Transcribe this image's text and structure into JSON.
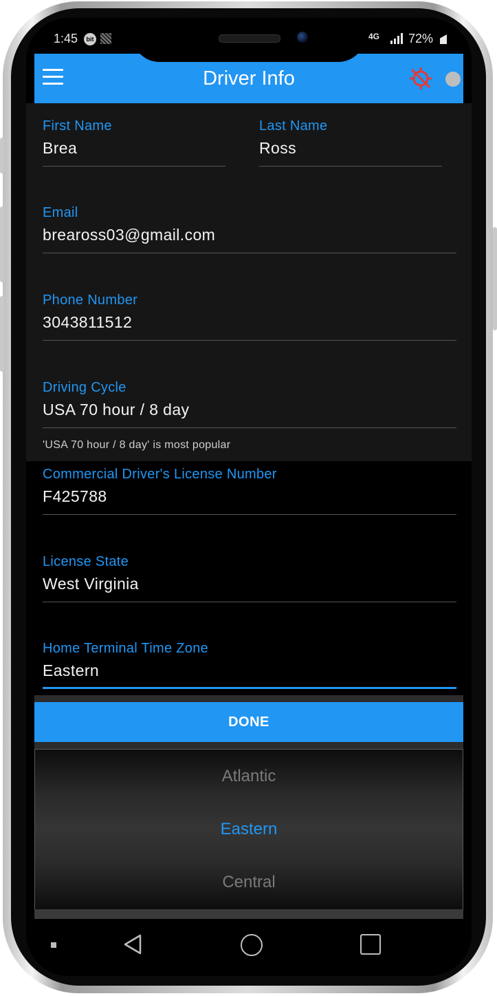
{
  "status_bar": {
    "time": "1:45",
    "bt_label": "bit",
    "network": "4G",
    "battery": "72%"
  },
  "app_bar": {
    "title": "Driver Info"
  },
  "form": {
    "first_name": {
      "label": "First Name",
      "value": "Brea"
    },
    "last_name": {
      "label": "Last Name",
      "value": "Ross"
    },
    "email": {
      "label": "Email",
      "value": "breaross03@gmail.com"
    },
    "phone": {
      "label": "Phone Number",
      "value": "3043811512"
    },
    "driving_cycle": {
      "label": "Driving Cycle",
      "value": "USA 70 hour / 8 day",
      "helper": "'USA 70 hour / 8 day' is most popular"
    },
    "license_number": {
      "label": "Commercial Driver's License Number",
      "value": "F425788"
    },
    "license_state": {
      "label": "License State",
      "value": "West Virginia"
    },
    "time_zone": {
      "label": "Home Terminal Time Zone",
      "value": "Eastern"
    }
  },
  "picker": {
    "done_label": "DONE",
    "options": [
      "Atlantic",
      "Eastern",
      "Central"
    ],
    "selected": "Eastern"
  },
  "colors": {
    "accent": "#2196f3",
    "background": "#161616",
    "gps_off": "#e53935"
  },
  "icons": {
    "menu": "hamburger-menu-icon",
    "gps": "gps-off-icon",
    "back": "back-triangle-icon",
    "home": "home-circle-icon",
    "recents": "recents-square-icon"
  }
}
